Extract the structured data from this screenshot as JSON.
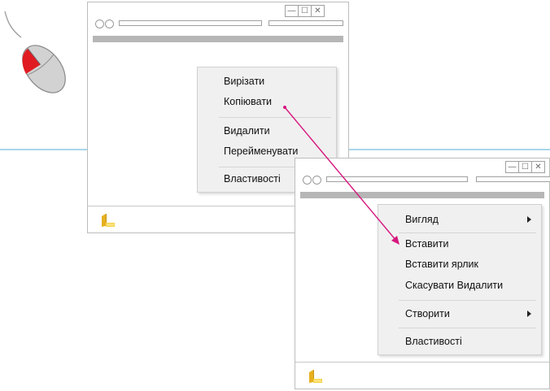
{
  "accent_color": "#d6177e",
  "window_controls": [
    "—",
    "☐",
    "✕"
  ],
  "window1": {
    "menu": {
      "items": [
        "Вирізати",
        "Копіювати",
        "Видалити",
        "Перейменувати",
        "Властивості"
      ]
    }
  },
  "window2": {
    "menu": {
      "items": [
        {
          "label": "Вигляд",
          "submenu": true
        },
        {
          "label": "Вставити",
          "submenu": false
        },
        {
          "label": "Вставити ярлик",
          "submenu": false
        },
        {
          "label": "Скасувати Видалити",
          "submenu": false
        },
        {
          "label": "Створити",
          "submenu": true
        },
        {
          "label": "Властивості",
          "submenu": false
        }
      ]
    }
  },
  "icons": [
    "mouse-icon",
    "folder-icon",
    "submenu-arrow-icon"
  ]
}
